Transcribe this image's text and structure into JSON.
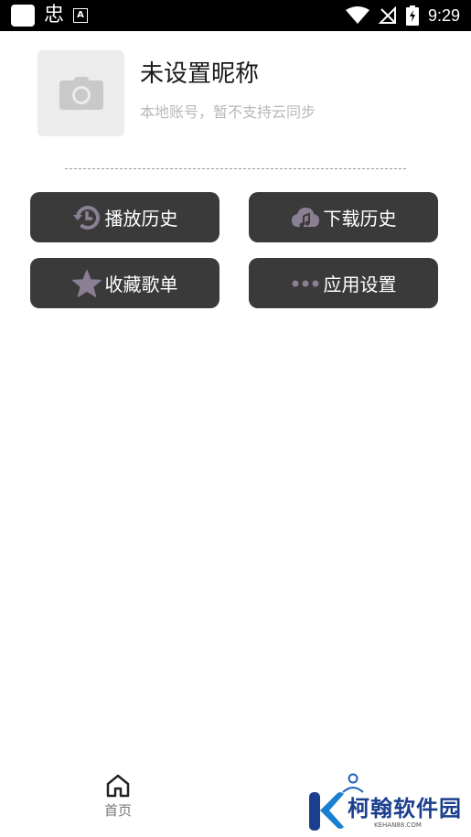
{
  "status_bar": {
    "time": "9:29",
    "app_glyph": "忠",
    "icons": [
      "notification-square-icon",
      "app-notification-icon",
      "a-icon",
      "wifi-icon",
      "no-signal-icon",
      "battery-charging-icon"
    ]
  },
  "profile": {
    "nickname": "未设置昵称",
    "account_note": "本地账号，暂不支持云同步",
    "avatar_icon": "camera-icon"
  },
  "menu": {
    "play_history": "播放历史",
    "download_history": "下载历史",
    "favorites": "收藏歌单",
    "settings": "应用设置"
  },
  "bottom_nav": {
    "home_label": "首页",
    "profile_icon": "person-icon"
  },
  "watermark": {
    "text": "柯翰软件园",
    "sub": "KEHAN88.COM"
  },
  "colors": {
    "button_bg": "#3a3a3a",
    "icon_accent": "#8a7f93",
    "watermark_blue": "#1b3f8f"
  }
}
